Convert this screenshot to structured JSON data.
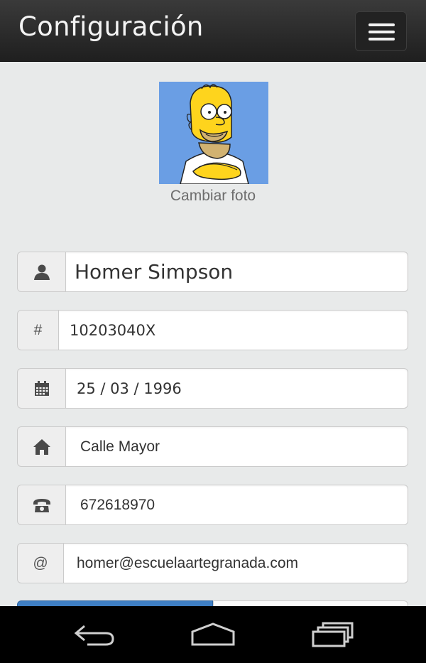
{
  "header": {
    "title": "Configuración"
  },
  "profile": {
    "change_photo_label": "Cambiar foto"
  },
  "form": {
    "name": {
      "icon": "user-icon",
      "value": "Homer Simpson"
    },
    "id_number": {
      "addon": "#",
      "value": "10203040X"
    },
    "birthdate": {
      "icon": "calendar-icon",
      "value": "25 / 03 / 1996"
    },
    "address": {
      "icon": "home-icon",
      "value": "Calle Mayor"
    },
    "phone": {
      "icon": "phone-icon",
      "value": "672618970"
    },
    "email": {
      "addon": "@",
      "value": "homer@escuelaartegranada.com"
    }
  },
  "colors": {
    "header_bg": "#2a2a2a",
    "page_bg": "#e8eaea",
    "primary_button": "#3f7fc4",
    "avatar_bg": "#6a9ee4"
  },
  "system_nav": {
    "icons": [
      "back-icon",
      "home-nav-icon",
      "recents-icon"
    ]
  }
}
